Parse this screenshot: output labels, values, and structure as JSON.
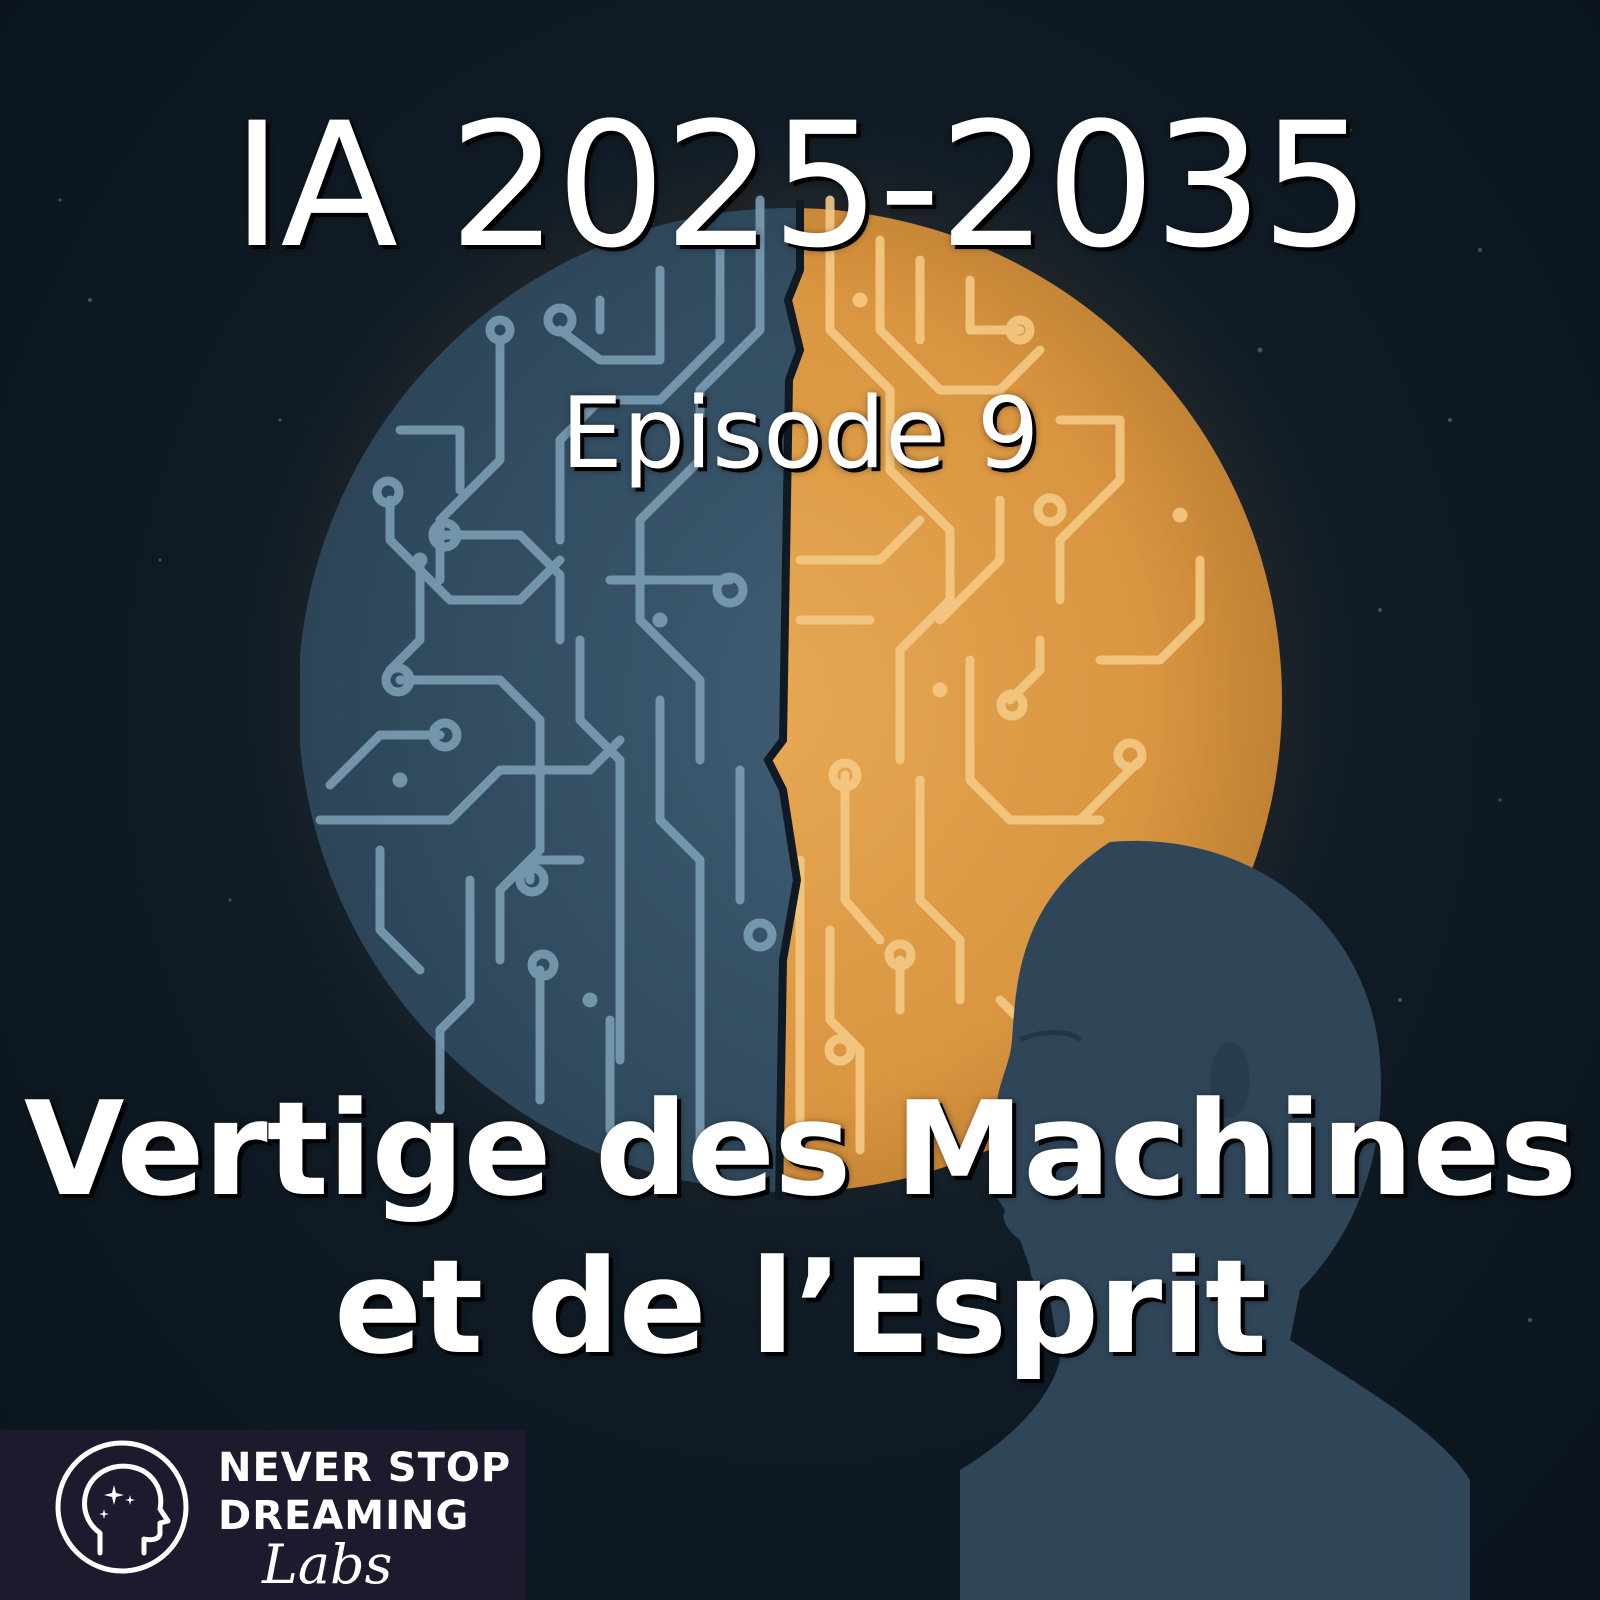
{
  "cover": {
    "title": "IA 2025-2035",
    "episode": "Episode 9",
    "subtitle_line1": "Vertige des Machines",
    "subtitle_line2": "et de l’Esprit"
  },
  "logo": {
    "line1": "NEVER STOP",
    "line2": "DREAMING",
    "script": "Labs",
    "icon": "head-with-stars-icon"
  },
  "colors": {
    "background": "#0f1a24",
    "brain_blue": "#3e5c73",
    "brain_orange": "#e0a050",
    "circuit_light_blue": "#7fa2b8",
    "circuit_light_orange": "#f4c985",
    "head": "#2f4659",
    "logo_box": "#1e1a2e",
    "text": "#ffffff"
  }
}
